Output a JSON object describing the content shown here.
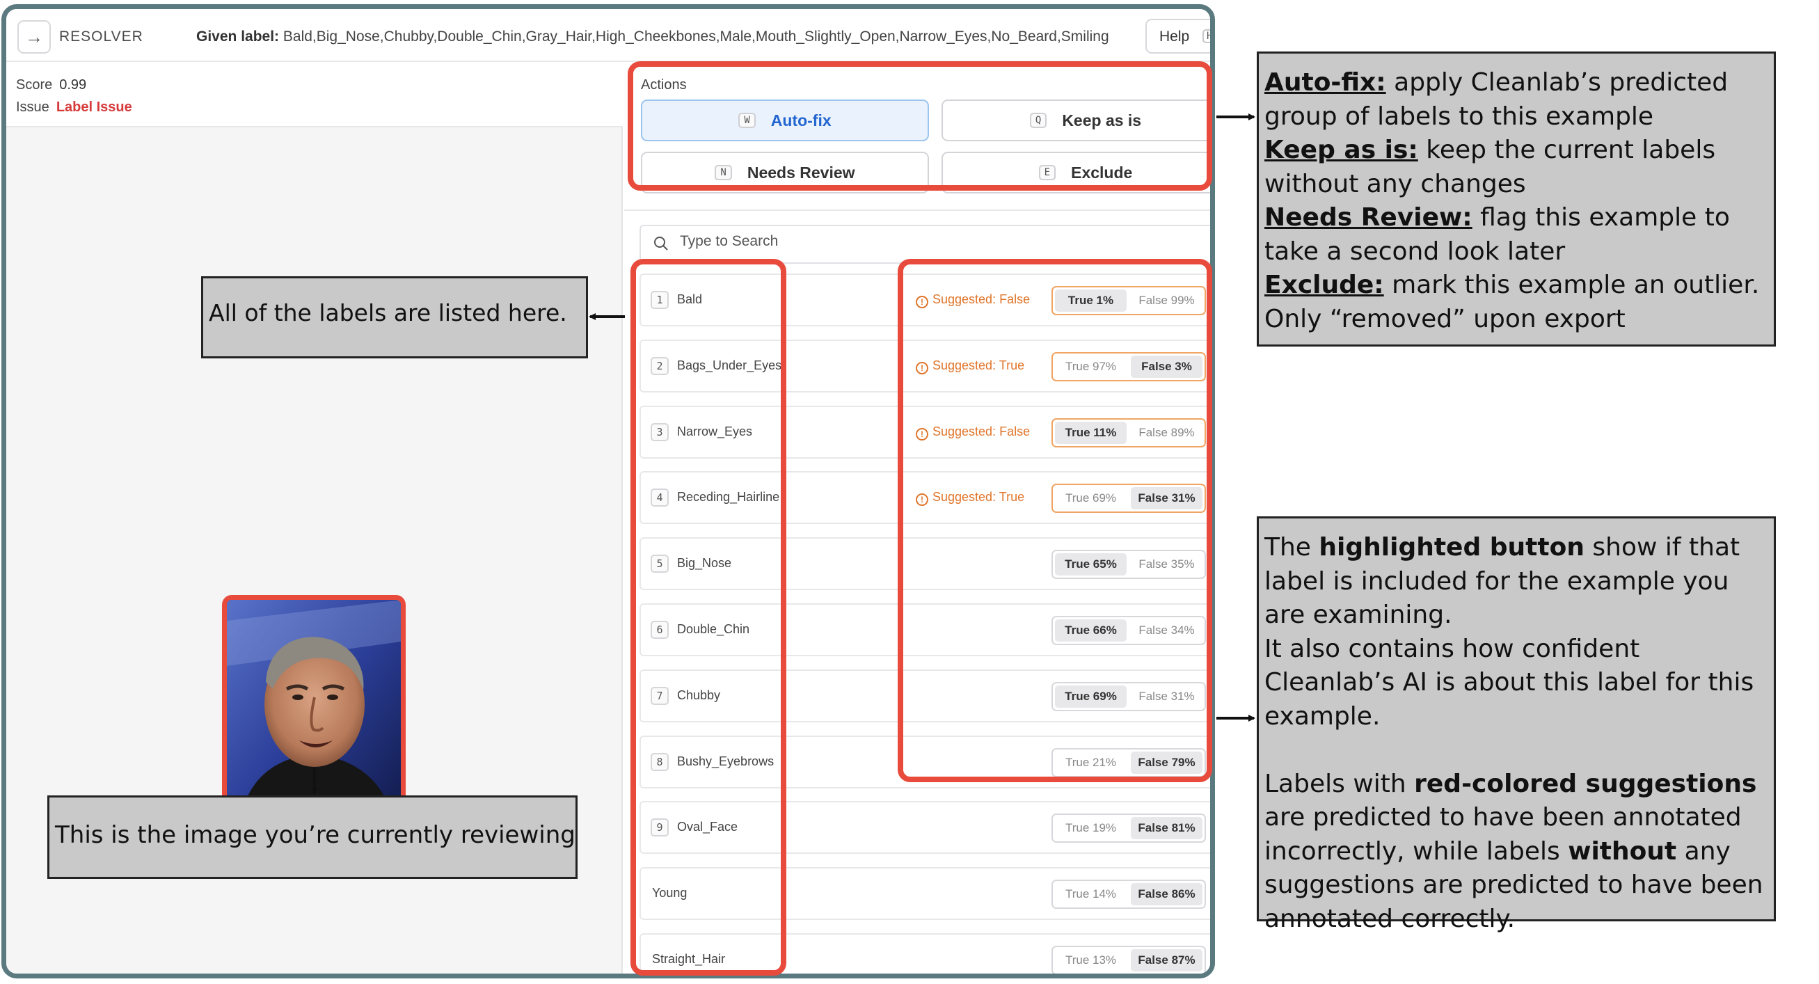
{
  "header": {
    "back_icon": "arrow-right-icon",
    "app_name": "RESOLVER",
    "given_label_prefix": "Given label:",
    "given_label_value": "Bald,Big_Nose,Chubby,Double_Chin,Gray_Hair,High_Cheekbones,Male,Mouth_Slightly_Open,Narrow_Eyes,No_Beard,Smiling",
    "help_label": "Help",
    "help_key": "H"
  },
  "summary": {
    "score_label": "Score",
    "score_value": "0.99",
    "issue_label": "Issue",
    "issue_value": "Label Issue"
  },
  "actions": {
    "title": "Actions",
    "buttons": [
      {
        "key": "W",
        "label": "Auto-fix"
      },
      {
        "key": "Q",
        "label": "Keep as is"
      },
      {
        "key": "N",
        "label": "Needs Review"
      },
      {
        "key": "E",
        "label": "Exclude"
      }
    ]
  },
  "search": {
    "placeholder": "Type to Search"
  },
  "labels": [
    {
      "num": "1",
      "name": "Bald",
      "suggestion": "Suggested: False",
      "true_text": "True 1%",
      "false_text": "False 99%",
      "selected": "true"
    },
    {
      "num": "2",
      "name": "Bags_Under_Eyes",
      "suggestion": "Suggested: True",
      "true_text": "True 97%",
      "false_text": "False 3%",
      "selected": "false"
    },
    {
      "num": "3",
      "name": "Narrow_Eyes",
      "suggestion": "Suggested: False",
      "true_text": "True 11%",
      "false_text": "False 89%",
      "selected": "true"
    },
    {
      "num": "4",
      "name": "Receding_Hairline",
      "suggestion": "Suggested: True",
      "true_text": "True 69%",
      "false_text": "False 31%",
      "selected": "false"
    },
    {
      "num": "5",
      "name": "Big_Nose",
      "suggestion": "",
      "true_text": "True 65%",
      "false_text": "False 35%",
      "selected": "true"
    },
    {
      "num": "6",
      "name": "Double_Chin",
      "suggestion": "",
      "true_text": "True 66%",
      "false_text": "False 34%",
      "selected": "true"
    },
    {
      "num": "7",
      "name": "Chubby",
      "suggestion": "",
      "true_text": "True 69%",
      "false_text": "False 31%",
      "selected": "true"
    },
    {
      "num": "8",
      "name": "Bushy_Eyebrows",
      "suggestion": "",
      "true_text": "True 21%",
      "false_text": "False 79%",
      "selected": "false"
    },
    {
      "num": "9",
      "name": "Oval_Face",
      "suggestion": "",
      "true_text": "True 19%",
      "false_text": "False 81%",
      "selected": "false"
    },
    {
      "num": "",
      "name": "Young",
      "suggestion": "",
      "true_text": "True 14%",
      "false_text": "False 86%",
      "selected": "false"
    },
    {
      "num": "",
      "name": "Straight_Hair",
      "suggestion": "",
      "true_text": "True 13%",
      "false_text": "False 87%",
      "selected": "false"
    }
  ],
  "callouts": {
    "labels_text": "All of the labels are listed here.",
    "image_text": "This is the image you’re currently reviewing",
    "actions": {
      "autofix_term": "Auto-fix:",
      "autofix_desc": " apply Cleanlab’s predicted group of labels to this example",
      "keep_term": "Keep as is:",
      "keep_desc": " keep the current labels without any changes",
      "review_term": "Needs Review:",
      "review_desc": " flag this example to take a second look later",
      "exclude_term": "Exclude:",
      "exclude_desc": " mark this example an outlier. Only “removed” upon export"
    },
    "highlight": {
      "p1_a": "The ",
      "p1_b": "highlighted button",
      "p1_c": " show if that label is included for the example you are examining.",
      "p2": "It also contains how confident Cleanlab’s AI is about this label for this example.",
      "p3_a": "Labels with ",
      "p3_b": "red-colored suggestions",
      "p3_c": " are predicted to have been annotated incorrectly, while labels ",
      "p3_d": "without",
      "p3_e": " any suggestions are predicted to have been annotated correctly."
    }
  },
  "colors": {
    "highlight_red": "#e84a3c",
    "suggestion_orange": "#e0752a",
    "frame_teal": "#5a7a80",
    "callout_gray": "#c9c9c9",
    "primary_blue": "#2466d1"
  }
}
